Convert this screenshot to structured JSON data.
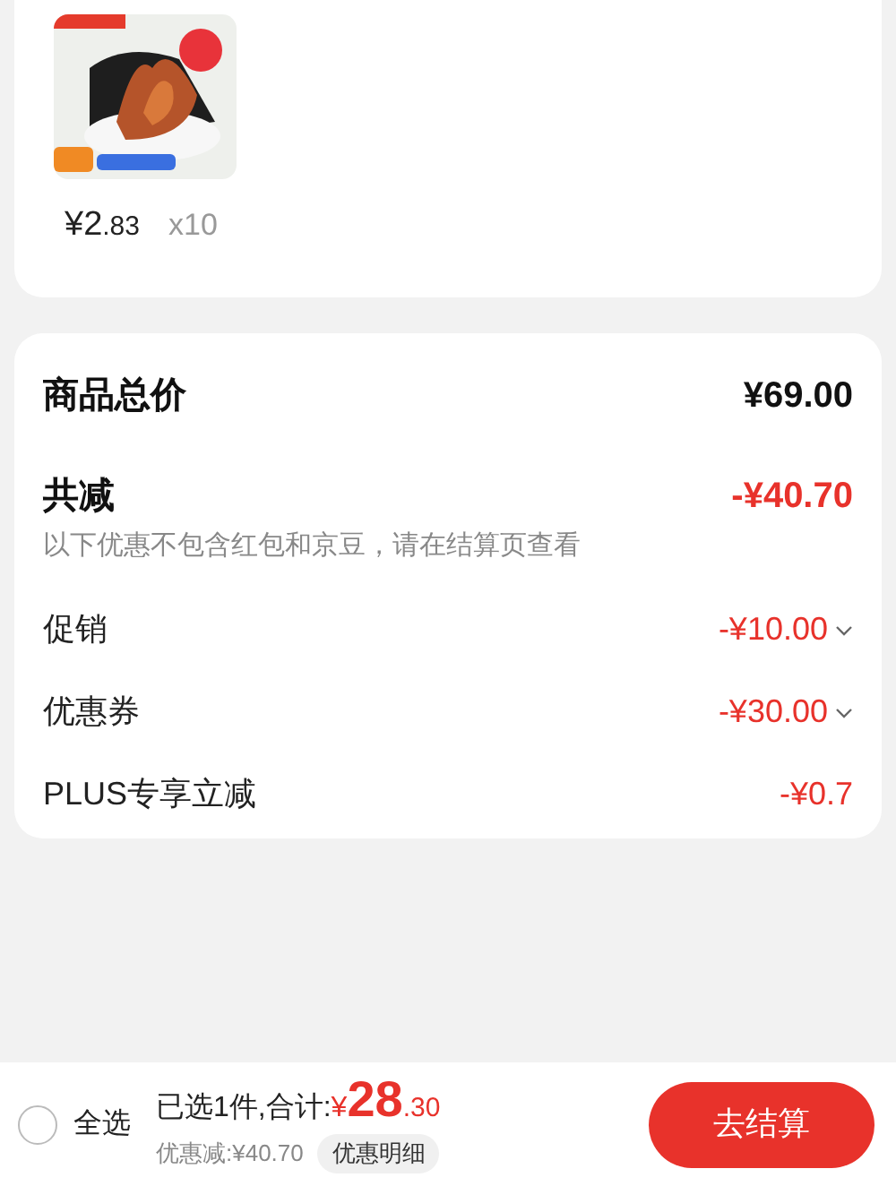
{
  "product": {
    "price_main": "¥2",
    "price_decimal": ".83",
    "quantity": "x10"
  },
  "summary": {
    "total_label": "商品总价",
    "total_value": "¥69.00",
    "discount_label": "共减",
    "discount_value": "-¥40.70",
    "note": "以下优惠不包含红包和京豆，请在结算页查看",
    "rows": [
      {
        "label": "促销",
        "value": "-¥10.00",
        "expandable": true
      },
      {
        "label": "优惠券",
        "value": "-¥30.00",
        "expandable": true
      },
      {
        "label": "PLUS专享立减",
        "value": "-¥0.7",
        "expandable": false
      }
    ]
  },
  "footer": {
    "select_all": {
      "label": "全选",
      "checked": false
    },
    "selected_text": "已选1件,合计:",
    "currency": "¥",
    "total_main": "28",
    "total_decimal": ".30",
    "saved": "优惠减:¥40.70",
    "detail_button": "优惠明细",
    "checkout_button": "去结算"
  }
}
